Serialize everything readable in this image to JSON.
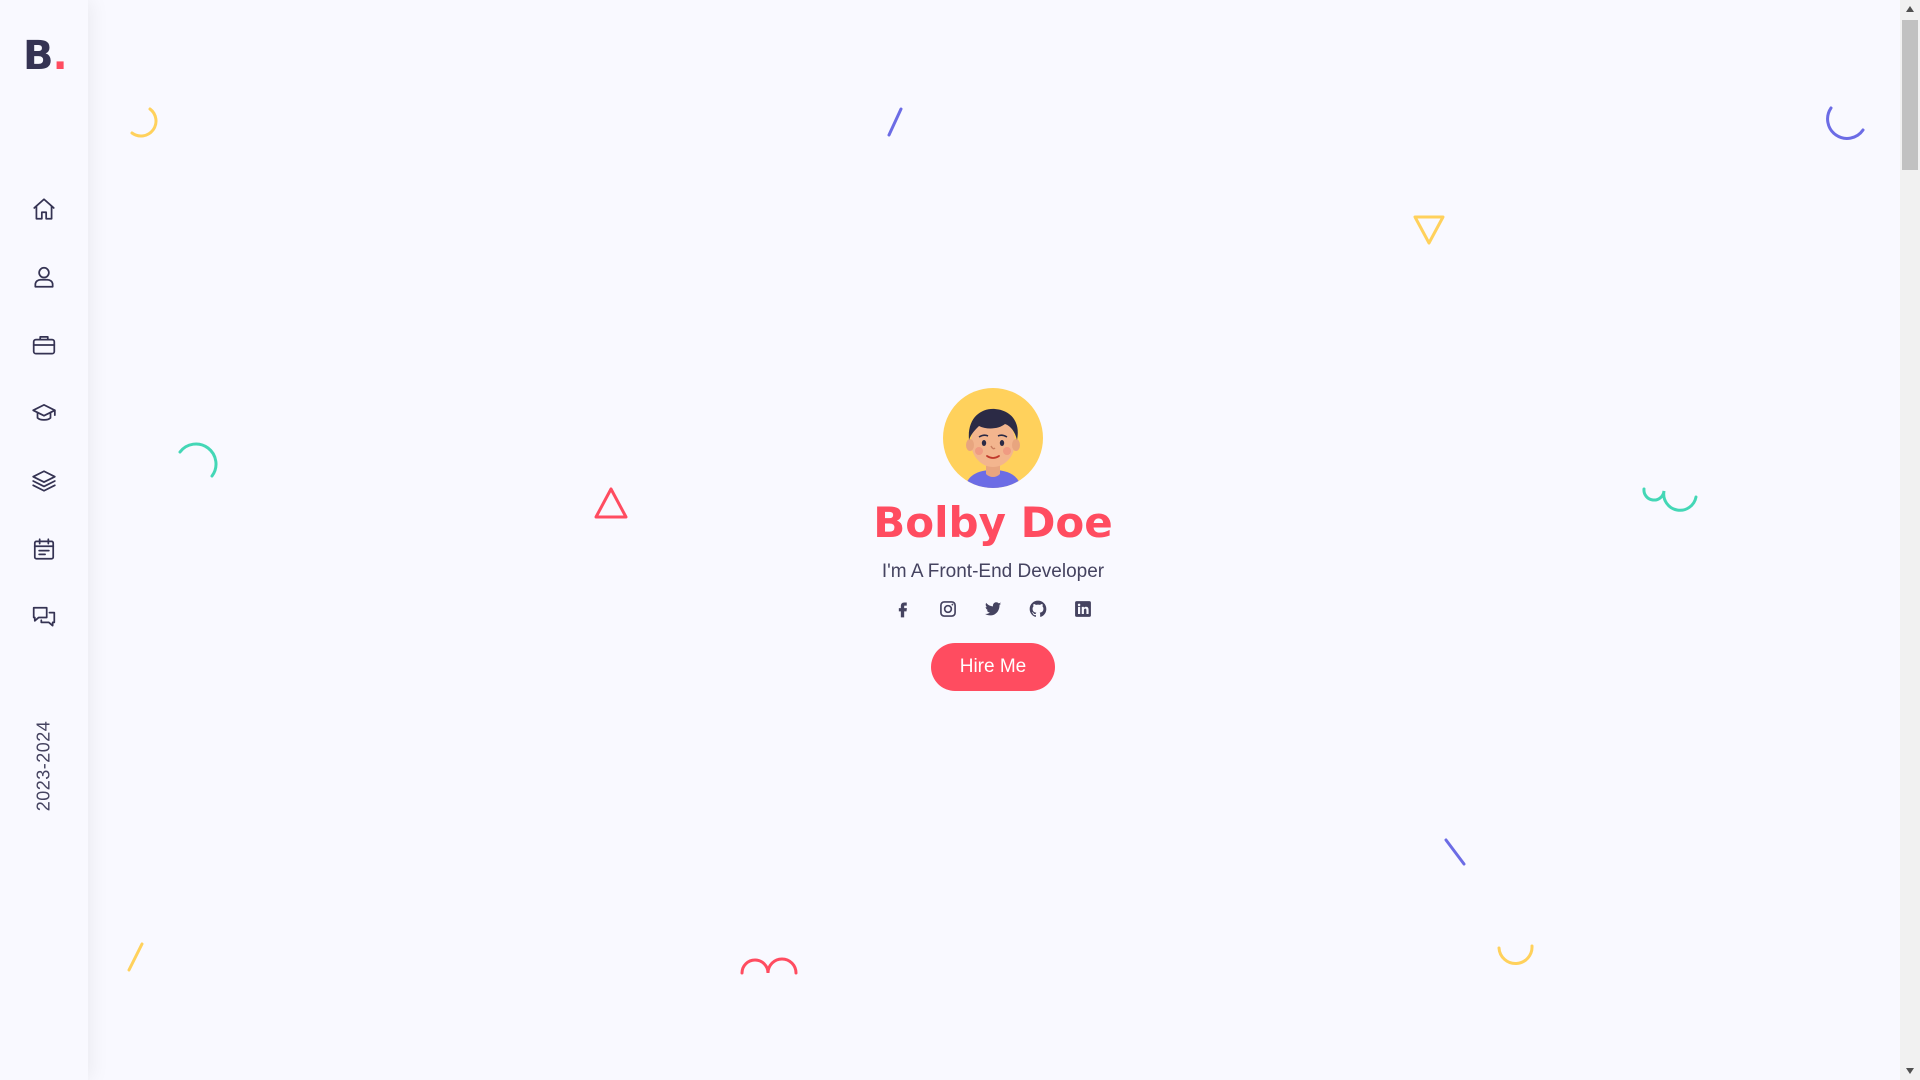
{
  "logo": {
    "letter": "B",
    "dot": "."
  },
  "sidebar": {
    "items": [
      {
        "icon": "home-icon"
      },
      {
        "icon": "user-icon"
      },
      {
        "icon": "briefcase-icon"
      },
      {
        "icon": "graduation-cap-icon"
      },
      {
        "icon": "layers-icon"
      },
      {
        "icon": "calendar-icon"
      },
      {
        "icon": "chat-icon"
      }
    ],
    "year": "2023-2024"
  },
  "hero": {
    "name": "Bolby Doe",
    "role": "I'm A Front-End Developer",
    "button": "Hire Me",
    "social": [
      "facebook-icon",
      "instagram-icon",
      "twitter-icon",
      "github-icon",
      "linkedin-icon"
    ]
  },
  "colors": {
    "accent": "#ff4c60",
    "yellow": "#ffd15c",
    "blue": "#6c6ce5",
    "green": "#44d7b6",
    "dark": "#353353",
    "text": "#454360",
    "background": "#f9f9ff"
  }
}
